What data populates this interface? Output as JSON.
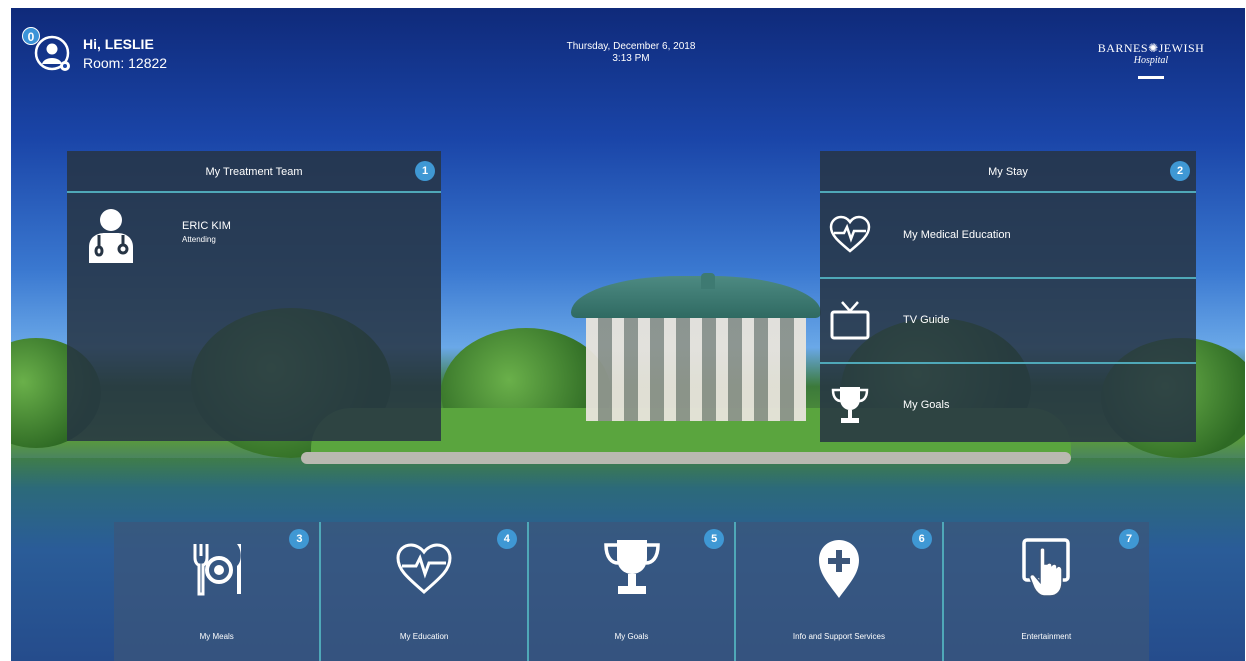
{
  "header": {
    "notification_count": "0",
    "greeting": "Hi, LESLIE",
    "room": "Room: 12822",
    "date": "Thursday, December 6, 2018",
    "time": "3:13 PM",
    "logo_text": "BARNES✺JEWISH",
    "logo_sub": "Hospital"
  },
  "treatment_team": {
    "title": "My Treatment Team",
    "badge": "1",
    "members": [
      {
        "name": "ERIC KIM",
        "role": "Attending",
        "icon": "doctor-icon"
      }
    ]
  },
  "my_stay": {
    "title": "My Stay",
    "badge": "2",
    "items": [
      {
        "label": "My Medical Education",
        "icon": "heartbeat-icon"
      },
      {
        "label": "TV Guide",
        "icon": "tv-icon"
      },
      {
        "label": "My Goals",
        "icon": "trophy-icon"
      }
    ]
  },
  "tiles": [
    {
      "label": "My Meals",
      "badge": "3",
      "icon": "meal-icon"
    },
    {
      "label": "My Education",
      "badge": "4",
      "icon": "heartbeat-icon"
    },
    {
      "label": "My Goals",
      "badge": "5",
      "icon": "trophy-icon"
    },
    {
      "label": "Info and Support Services",
      "badge": "6",
      "icon": "location-plus-icon"
    },
    {
      "label": "Entertainment",
      "badge": "7",
      "icon": "tablet-touch-icon"
    }
  ],
  "colors": {
    "panel_bg": "#263444",
    "accent_line": "#4fa8b8",
    "badge": "#3f98d4"
  }
}
